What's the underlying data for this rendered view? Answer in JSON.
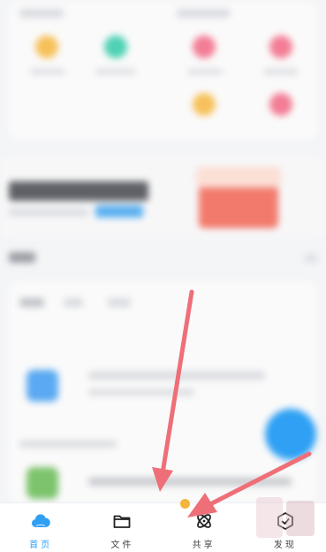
{
  "tabbar": {
    "tabs": [
      {
        "label": "首页",
        "icon": "cloud-icon",
        "active": true
      },
      {
        "label": "文件",
        "icon": "folder-icon",
        "active": false
      },
      {
        "label": "共享",
        "icon": "atom-icon",
        "active": false
      },
      {
        "label": "发现",
        "icon": "compass-icon",
        "active": false
      }
    ]
  },
  "colors": {
    "accent": "#2fa0f4",
    "arrow": "#ee6f78",
    "badge": "#f5b43a"
  }
}
